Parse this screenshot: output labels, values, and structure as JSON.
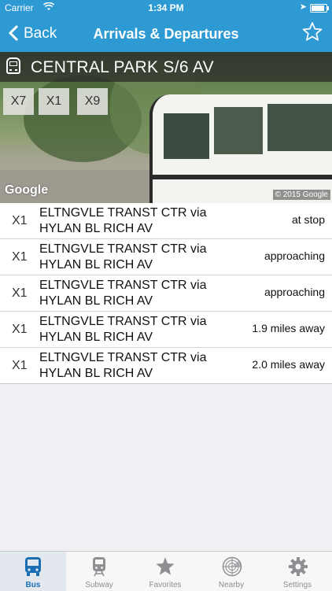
{
  "status_bar": {
    "carrier": "Carrier",
    "time": "1:34 PM"
  },
  "nav": {
    "back_label": "Back",
    "title": "Arrivals & Departures"
  },
  "stop": {
    "name": "CENTRAL PARK S/6 AV",
    "routes": [
      "X7",
      "X1",
      "X9"
    ],
    "map_attribution": "Google",
    "copyright": "© 2015 Google"
  },
  "arrivals": [
    {
      "route": "X1",
      "destination": "ELTNGVLE TRANST CTR via HYLAN BL RICH AV",
      "status": "at stop"
    },
    {
      "route": "X1",
      "destination": "ELTNGVLE TRANST CTR via HYLAN BL RICH AV",
      "status": "approaching"
    },
    {
      "route": "X1",
      "destination": "ELTNGVLE TRANST CTR via HYLAN BL RICH AV",
      "status": "approaching"
    },
    {
      "route": "X1",
      "destination": "ELTNGVLE TRANST CTR via HYLAN BL RICH AV",
      "status": "1.9 miles away"
    },
    {
      "route": "X1",
      "destination": "ELTNGVLE TRANST CTR via HYLAN BL RICH AV",
      "status": "2.0 miles away"
    }
  ],
  "tabs": [
    {
      "label": "Bus",
      "icon": "bus-icon",
      "active": true
    },
    {
      "label": "Subway",
      "icon": "train-icon",
      "active": false
    },
    {
      "label": "Favorites",
      "icon": "star-icon",
      "active": false
    },
    {
      "label": "Nearby",
      "icon": "radar-icon",
      "active": false
    },
    {
      "label": "Settings",
      "icon": "gear-icon",
      "active": false
    }
  ],
  "colors": {
    "accent": "#2e9ad3",
    "active_tab": "#1a6fb4",
    "inactive_tab": "#8e8e93"
  }
}
